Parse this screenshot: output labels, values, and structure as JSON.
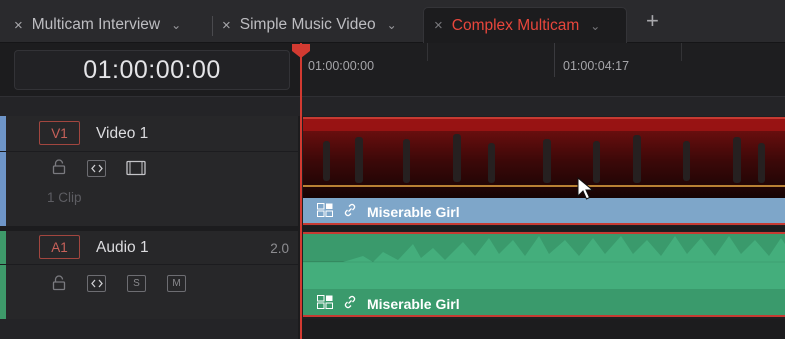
{
  "tabs": [
    {
      "label": "Multicam Interview",
      "active": false
    },
    {
      "label": "Simple Music Video",
      "active": false
    },
    {
      "label": "Complex Multicam",
      "active": true
    }
  ],
  "glyphs": {
    "close": "×",
    "chevron": "⌄",
    "plus": "+"
  },
  "timecode": "01:00:00:00",
  "ruler": {
    "labels": [
      "01:00:00:00",
      "01:00:04:17"
    ]
  },
  "tracks": {
    "video": {
      "tag": "V1",
      "name": "Video 1",
      "clip_count": "1 Clip",
      "color": "#6e95c8"
    },
    "audio": {
      "tag": "A1",
      "name": "Audio 1",
      "channels": "2.0",
      "solo": "S",
      "mute": "M",
      "color": "#3e9a6a"
    }
  },
  "clips": {
    "video": {
      "label": "Miserable Girl",
      "color": "#7ea6c9"
    },
    "audio": {
      "label": "Miserable Girl",
      "color": "#3a9a6c"
    }
  },
  "colors": {
    "accent": "#e8463c",
    "playhead": "#d23a31",
    "clip_border": "#c63a32"
  }
}
